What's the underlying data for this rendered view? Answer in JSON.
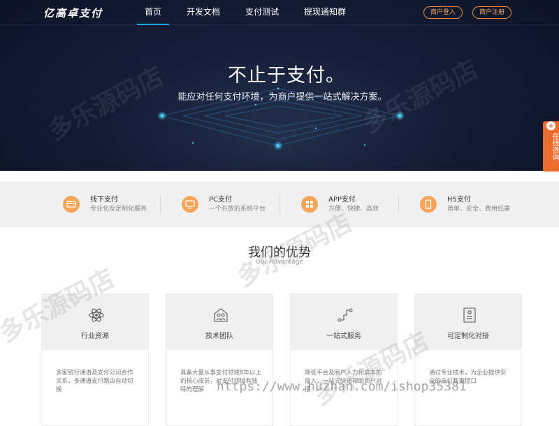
{
  "header": {
    "logo": "亿高卓支付",
    "nav": [
      {
        "label": "首页",
        "active": true
      },
      {
        "label": "开发文档",
        "active": false
      },
      {
        "label": "支付测试",
        "active": false
      },
      {
        "label": "提现通知群",
        "active": false
      }
    ],
    "login_label": "商户登入",
    "register_label": "商户注册"
  },
  "hero": {
    "title": "不止于支付。",
    "subtitle": "能应对任何支付环境，为商户提供一站式解决方案。"
  },
  "consult": {
    "plus": "+",
    "label": "在线咨询"
  },
  "features": [
    {
      "title": "线下支付",
      "desc": "专业化及定制化服务",
      "icon": "store-icon"
    },
    {
      "title": "PC支付",
      "desc": "一个开放的系统平台",
      "icon": "monitor-icon"
    },
    {
      "title": "APP支付",
      "desc": "方便、快捷、高效",
      "icon": "app-icon"
    },
    {
      "title": "H5支付",
      "desc": "简单、安全、费用低廉",
      "icon": "mobile-icon"
    }
  ],
  "advantage": {
    "title": "我们的优势",
    "subtitle": "Our Advantage",
    "cards": [
      {
        "title": "行业资源",
        "desc": "多家银行通道及支付公司合作关系，多通道支付路由自动切换",
        "icon": "atom-icon"
      },
      {
        "title": "技术团队",
        "desc": "具备大量从事支付领域8年以上的核心成员，对支付领域有独特的理解",
        "icon": "team-icon"
      },
      {
        "title": "一站式服务",
        "desc": "降低平台及商户人力和成本的投入，一站式快速帮助商户对接",
        "icon": "flow-icon"
      },
      {
        "title": "可定制化对接",
        "desc": "通过专业技术，为企业提供安全的支付数据接口",
        "icon": "document-icon"
      }
    ]
  },
  "watermark": {
    "text": "多乐源码店",
    "url": "https://www.huzhan.com/ishop35381"
  },
  "colors": {
    "accent_orange": "#ef6c2f",
    "feature_icon": "#f6a559",
    "nav_active": "#2aa3e6",
    "hero_dark": "#16203a"
  }
}
